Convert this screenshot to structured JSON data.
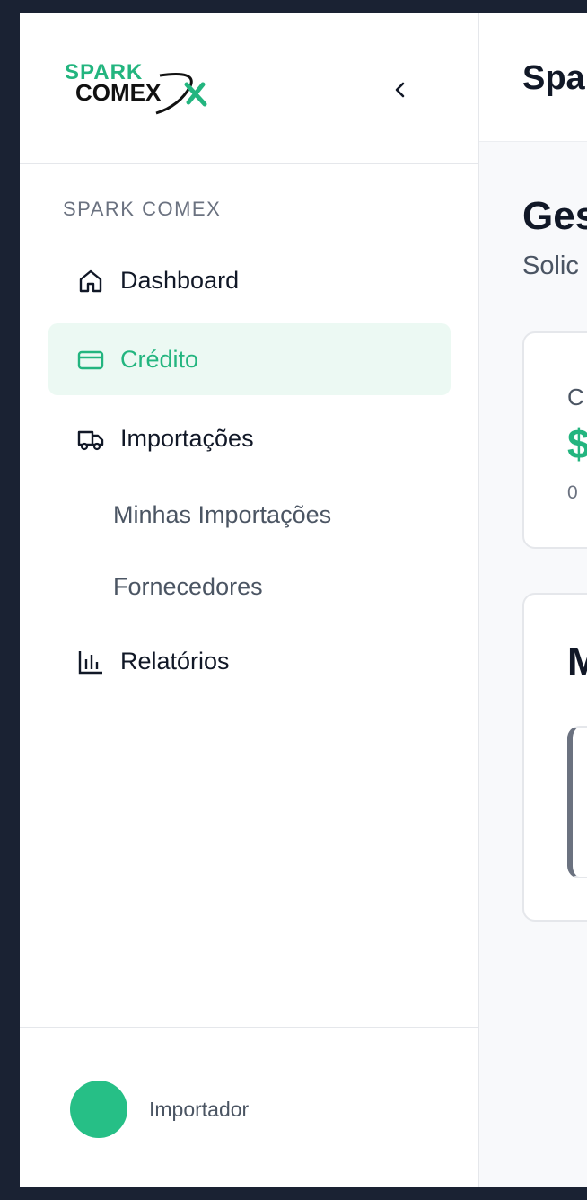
{
  "brand": {
    "logo_line1": "SPARK",
    "logo_line2": "COMEX",
    "accent": "#23b57f"
  },
  "sidebar": {
    "section_title": "SPARK COMEX",
    "items": [
      {
        "label": "Dashboard",
        "icon": "home-icon",
        "active": false
      },
      {
        "label": "Crédito",
        "icon": "credit-card-icon",
        "active": true
      },
      {
        "label": "Importações",
        "icon": "truck-icon",
        "active": false
      },
      {
        "label": "Relatórios",
        "icon": "bar-chart-icon",
        "active": false
      }
    ],
    "sub_items": [
      "Minhas Importações",
      "Fornecedores"
    ],
    "footer": {
      "role": "Importador"
    }
  },
  "main": {
    "app_title": "Spa",
    "page_title": "Ges",
    "page_subtitle": "Solic",
    "card1": {
      "label": "C",
      "value": "$",
      "count": "0"
    },
    "card2": {
      "title": "M"
    }
  }
}
